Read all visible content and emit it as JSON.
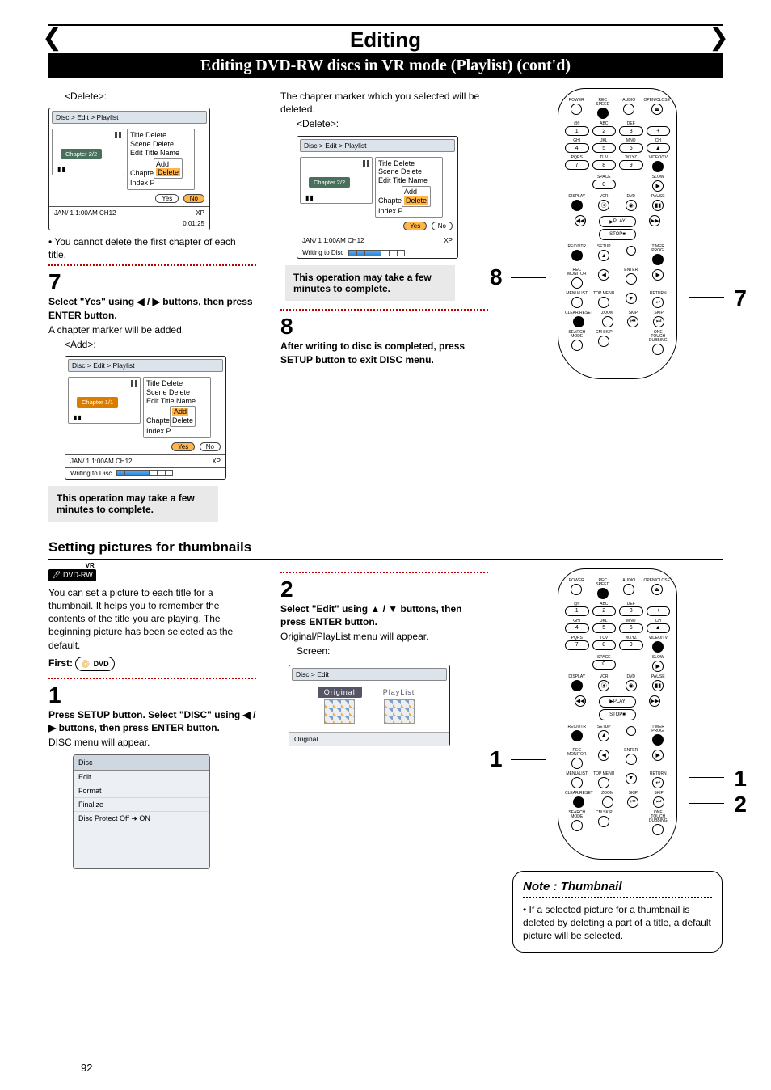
{
  "header": {
    "title": "Editing",
    "subtitle": "Editing DVD-RW discs in VR mode (Playlist) (cont'd)"
  },
  "top_section": {
    "delete_label": "<Delete>:",
    "osd_a": {
      "crumb": "Disc > Edit > Playlist",
      "chapter": "Chapter 2/2",
      "menu": [
        "Title Delete",
        "Scene Delete",
        "Edit Title Name",
        "Chapter",
        "Index Picture"
      ],
      "submenu": [
        "Add",
        "Delete"
      ],
      "sub_sel": "Delete",
      "yes": "Yes",
      "no": "No",
      "yn_sel": "no",
      "status_l": "JAN/ 1   1:00AM  CH12",
      "status_r": "XP",
      "time": "0:01:25"
    },
    "note1": "You cannot delete the first chapter of each title.",
    "step7_num": "7",
    "step7_bold": "Select \"Yes\" using ◀ / ▶ buttons, then press ENTER button.",
    "step7_txt": "A chapter marker will be added.",
    "add_label": "<Add>:",
    "osd_b": {
      "crumb": "Disc > Edit > Playlist",
      "chapter": "Chapter 1/1",
      "menu": [
        "Title Delete",
        "Scene Delete",
        "Edit Title Name",
        "Chapter",
        "Index Picture"
      ],
      "submenu": [
        "Add",
        "Delete"
      ],
      "sub_sel": "Add",
      "yes": "Yes",
      "no": "No",
      "yn_sel": "yes",
      "status_l": "JAN/ 1   1:00AM  CH12",
      "status_r": "XP",
      "writing": "Writing to Disc"
    },
    "notebox_a": "This operation may take a few minutes to complete.",
    "mid_txt": "The chapter marker which you selected will be deleted.",
    "delete_label2": "<Delete>:",
    "osd_c": {
      "crumb": "Disc > Edit > Playlist",
      "chapter": "Chapter 2/2",
      "menu": [
        "Title Delete",
        "Scene Delete",
        "Edit Title Name",
        "Chapter",
        "Index Picture"
      ],
      "submenu": [
        "Add",
        "Delete"
      ],
      "sub_sel": "Delete",
      "yes": "Yes",
      "no": "No",
      "yn_sel": "yes",
      "status_l": "JAN/ 1   1:00AM  CH12",
      "status_r": "XP",
      "writing": "Writing to Disc"
    },
    "notebox_b": "This operation may take a few minutes to complete.",
    "step8_num": "8",
    "step8_bold": "After writing to disc is completed, press SETUP button to exit DISC menu.",
    "callout_8": "8",
    "callout_7": "7"
  },
  "thumb_section": {
    "title": "Setting pictures for thumbnails",
    "badge_vr": "VR",
    "badge_dvdrw": "DVD-RW",
    "intro": "You can set a picture to each title for a thumbnail. It helps you to remember the contents of the title you are playing. The beginning picture has been selected as the default.",
    "first_label": "First:",
    "step1_num": "1",
    "step1_bold": "Press SETUP button. Select \"DISC\" using ◀ / ▶ buttons, then press ENTER button.",
    "step1_txt": "DISC menu will appear.",
    "disc_menu": {
      "header": "Disc",
      "items": [
        "Edit",
        "Format",
        "Finalize",
        "Disc Protect Off ➜ ON"
      ]
    },
    "step2_num": "2",
    "step2_bold": "Select \"Edit\" using ▲ / ▼ buttons, then press ENTER button.",
    "step2_txt": "Original/PlayList menu will appear.",
    "screen_label": "Screen:",
    "osd_edit": {
      "crumb": "Disc > Edit",
      "opt1": "Original",
      "opt2": "PlayList",
      "footer": "Original"
    },
    "note_title": "Note : Thumbnail",
    "note_body": "If a selected picture for a thumbnail is deleted by deleting a part of a title, a default picture will be selected.",
    "callout_1a": "1",
    "callout_1b": "1",
    "callout_2": "2"
  },
  "remote_labels": {
    "row1": [
      "POWER",
      "REC SPEED",
      "AUDIO",
      "OPEN/CLOSE"
    ],
    "row2": [
      "@!:",
      "ABC",
      "DEF",
      ""
    ],
    "nums2": [
      "1",
      "2",
      "3",
      "+"
    ],
    "row3": [
      "GHI",
      "JKL",
      "MNO",
      "CH"
    ],
    "nums3": [
      "4",
      "5",
      "6",
      "▲"
    ],
    "row4": [
      "PQRS",
      "TUV",
      "WXYZ",
      "VIDEO/TV"
    ],
    "nums4": [
      "7",
      "8",
      "9",
      ""
    ],
    "row5": [
      "",
      "SPACE",
      "",
      "SLOW"
    ],
    "nums5": [
      "",
      "0",
      "",
      "▶"
    ],
    "row6": [
      "DISPLAY",
      "VCR",
      "DVD",
      "PAUSE"
    ],
    "play": "PLAY",
    "stop": "STOP",
    "rowA": [
      "REC/OTR",
      "SETUP",
      "",
      "TIMER PROG."
    ],
    "rowB": [
      "",
      "",
      "ENTER",
      ""
    ],
    "rowC": [
      "REC MONITOR",
      "",
      "",
      ""
    ],
    "rowD": [
      "MENU/LIST",
      "TOP MENU",
      "",
      "RETURN"
    ],
    "rowE": [
      "CLEAR/RESET",
      "ZOOM",
      "SKIP",
      "SKIP"
    ],
    "rowF": [
      "SEARCH MODE",
      "CM SKIP",
      "",
      "ONE TOUCH DUBBING"
    ]
  },
  "page_number": "92"
}
